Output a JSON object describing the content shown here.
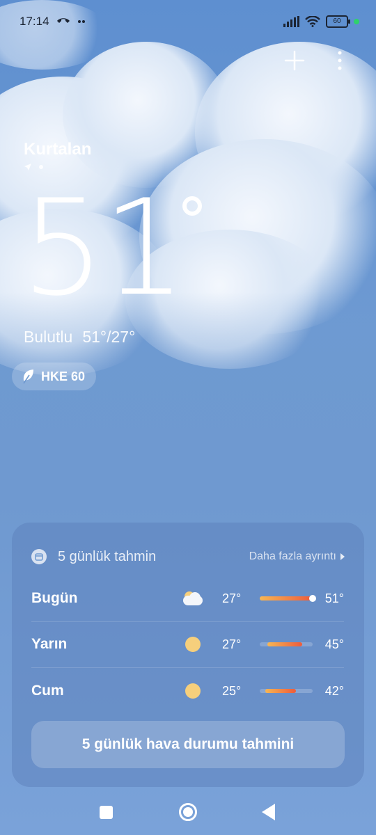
{
  "status_bar": {
    "time": "17:14",
    "battery": "60",
    "icons": [
      "phone-icon",
      "dots-icon",
      "signal-icon",
      "wifi-icon",
      "battery-icon"
    ]
  },
  "location": {
    "city": "Kurtalan"
  },
  "current": {
    "temperature": "51",
    "condition": "Bulutlu",
    "high_low": "51°/27°"
  },
  "air_quality": {
    "label": "HKE 60"
  },
  "forecast": {
    "title": "5 günlük tahmin",
    "more_label": "Daha fazla ayrıntı",
    "days": [
      {
        "day": "Bugün",
        "icon": "partly-cloudy-icon",
        "low": "27°",
        "high": "51°",
        "range_start": 0.0,
        "range_end": 1.0,
        "current_marker": 1.0
      },
      {
        "day": "Yarın",
        "icon": "sunny-icon",
        "low": "27°",
        "high": "45°",
        "range_start": 0.15,
        "range_end": 0.8
      },
      {
        "day": "Cum",
        "icon": "sunny-icon",
        "low": "25°",
        "high": "42°",
        "range_start": 0.1,
        "range_end": 0.68
      }
    ],
    "button_label": "5 günlük hava durumu tahmini"
  },
  "colors": {
    "background": "#6f99d0",
    "bar_start": "#f7b653",
    "bar_end": "#ee5b3b",
    "sun": "#f6cf7c"
  }
}
